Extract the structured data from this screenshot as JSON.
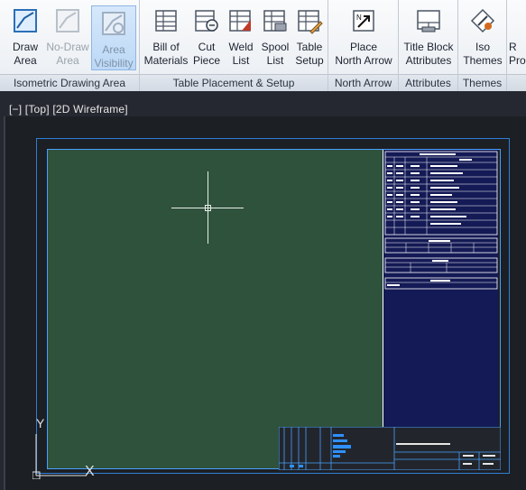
{
  "ribbon": {
    "panels": [
      {
        "title": "Isometric Drawing Area",
        "tools": [
          {
            "label1": "Draw",
            "label2": "Area",
            "icon": "draw-area-icon",
            "state": "normal"
          },
          {
            "label1": "No-Draw",
            "label2": "Area",
            "icon": "no-draw-area-icon",
            "state": "disabled"
          },
          {
            "label1": "Area",
            "label2": "Visibility",
            "icon": "area-visibility-icon",
            "state": "active"
          }
        ]
      },
      {
        "title": "Table Placement & Setup",
        "tools": [
          {
            "label1": "Bill of",
            "label2": "Materials",
            "icon": "bill-of-materials-icon"
          },
          {
            "label1": "Cut",
            "label2": "Piece",
            "icon": "cut-piece-icon"
          },
          {
            "label1": "Weld",
            "label2": "List",
            "icon": "weld-list-icon"
          },
          {
            "label1": "Spool",
            "label2": "List",
            "icon": "spool-list-icon"
          },
          {
            "label1": "Table",
            "label2": "Setup",
            "icon": "table-setup-icon"
          }
        ]
      },
      {
        "title": "North Arrow",
        "tools": [
          {
            "label1": "Place",
            "label2": "North Arrow",
            "icon": "north-arrow-icon"
          }
        ]
      },
      {
        "title": "Attributes",
        "tools": [
          {
            "label1": "Title Block",
            "label2": "Attributes",
            "icon": "title-block-attributes-icon"
          }
        ]
      },
      {
        "title": "Themes",
        "tools": [
          {
            "label1": "Iso",
            "label2": "Themes",
            "icon": "iso-themes-icon"
          }
        ]
      },
      {
        "title": "",
        "tools": [
          {
            "label1": "R",
            "label2": "Pro",
            "icon": "partial-icon"
          }
        ]
      }
    ]
  },
  "viewport": {
    "label": "[−] [Top] [2D Wireframe]",
    "ucs_x": "X",
    "ucs_y": "Y"
  },
  "colors": {
    "draw_area": "#2f523c",
    "table_area": "#141a55",
    "sheet_border": "#4aa0ff",
    "ribbon_bg": "#eef1f5",
    "active_tool": "#c8dff8"
  }
}
